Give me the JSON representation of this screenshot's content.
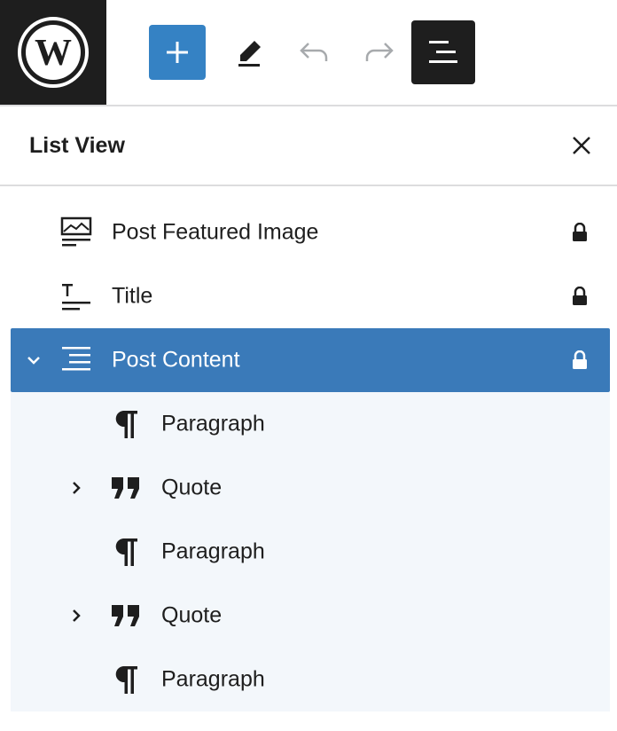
{
  "colors": {
    "accent": "#3582c4",
    "selected": "#3a7ab9",
    "dark": "#1e1e1e",
    "nested_bg": "#f3f7fb"
  },
  "toolbar": {
    "logo_icon": "wordpress-logo-icon",
    "add_icon": "plus-icon",
    "edit_icon": "pencil-icon",
    "undo_icon": "undo-icon",
    "redo_icon": "redo-icon",
    "list_view_icon": "list-view-icon"
  },
  "panel": {
    "title": "List View",
    "close_icon": "close-icon"
  },
  "blocks": [
    {
      "label": "Post Featured Image",
      "icon": "featured-image-icon",
      "locked": true
    },
    {
      "label": "Title",
      "icon": "title-icon",
      "locked": true
    },
    {
      "label": "Post Content",
      "icon": "post-content-icon",
      "locked": true,
      "selected": true,
      "expanded": true,
      "children": [
        {
          "label": "Paragraph",
          "icon": "paragraph-icon"
        },
        {
          "label": "Quote",
          "icon": "quote-icon",
          "expandable": true
        },
        {
          "label": "Paragraph",
          "icon": "paragraph-icon"
        },
        {
          "label": "Quote",
          "icon": "quote-icon",
          "expandable": true
        },
        {
          "label": "Paragraph",
          "icon": "paragraph-icon"
        }
      ]
    }
  ]
}
